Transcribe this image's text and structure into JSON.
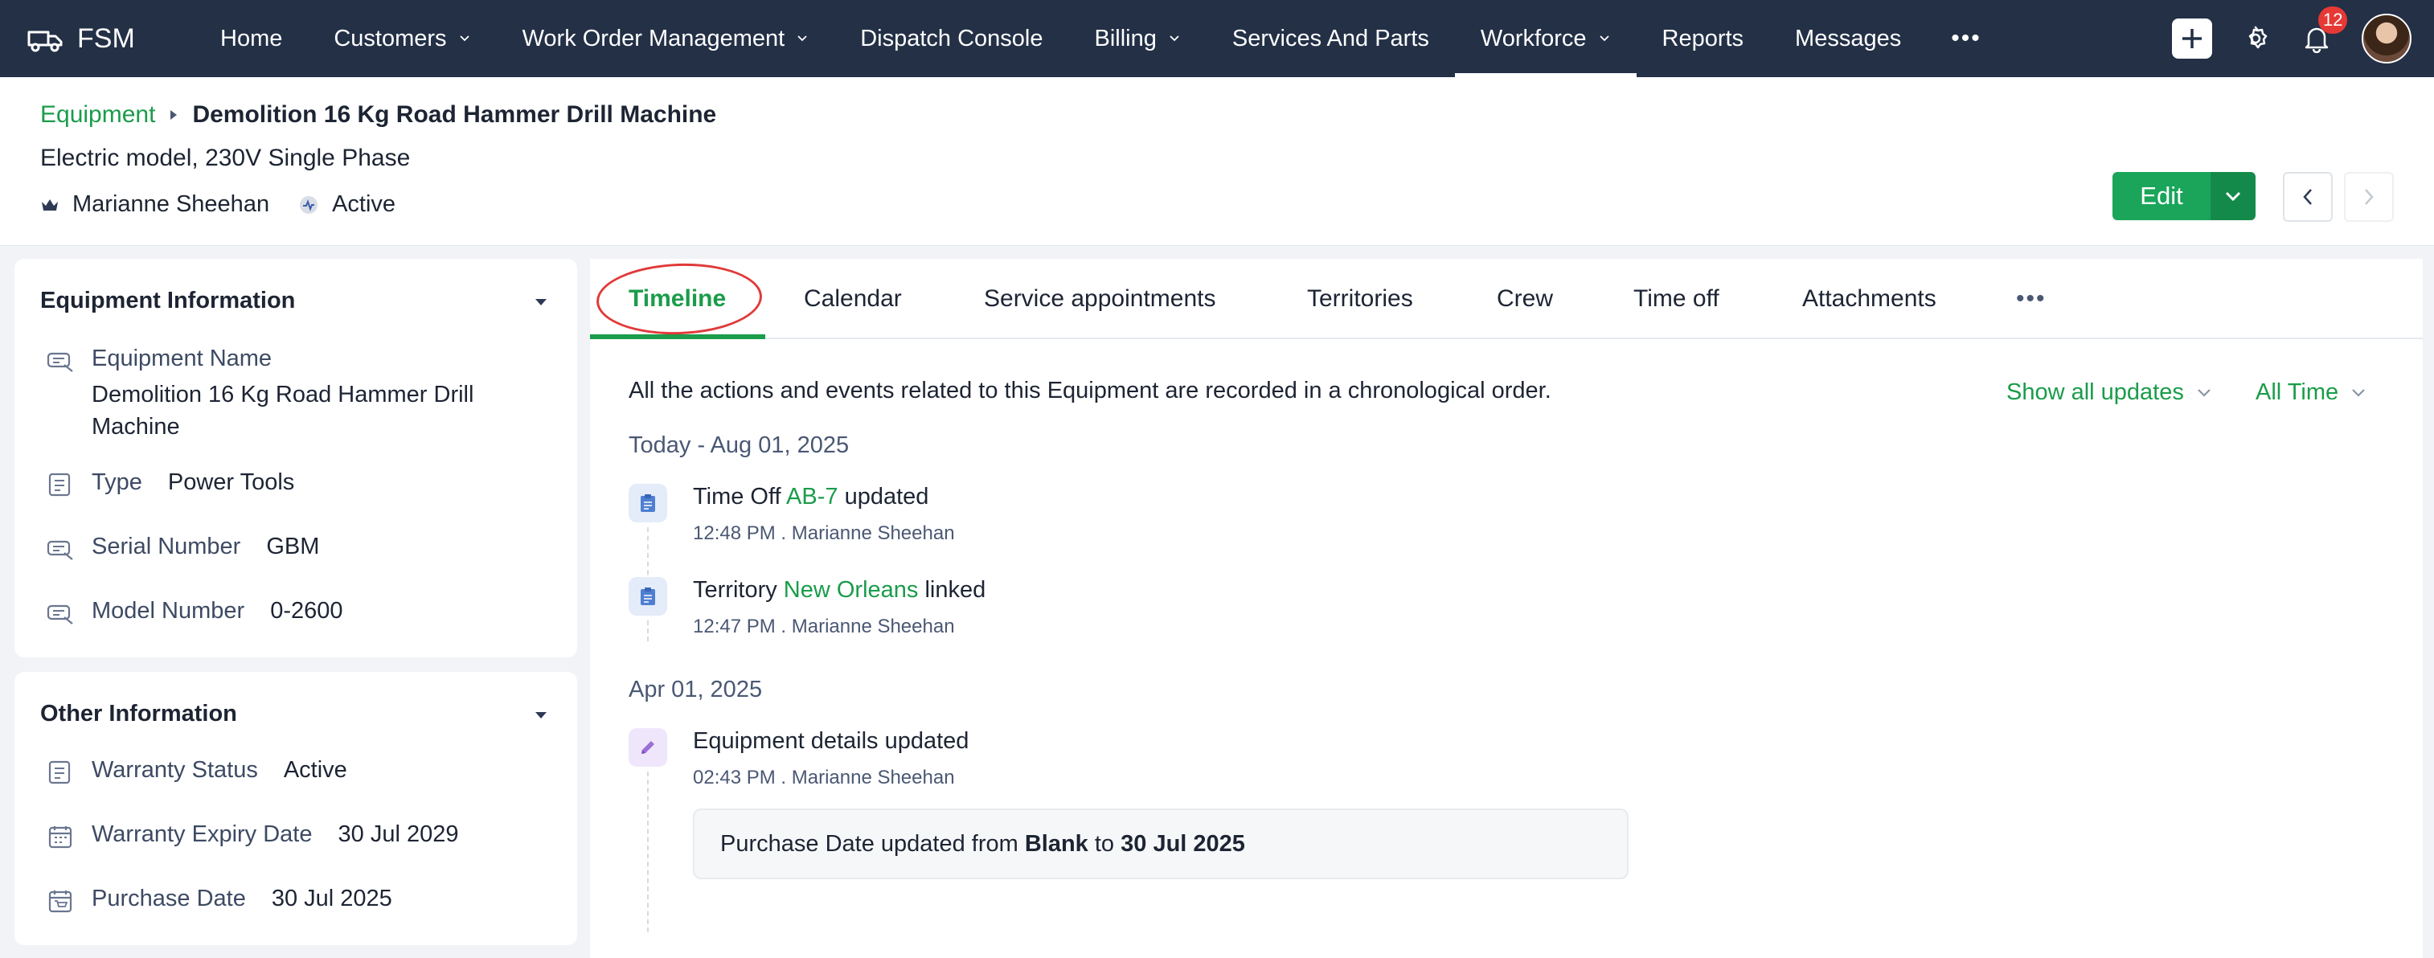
{
  "app": {
    "name": "FSM"
  },
  "nav": {
    "items": [
      {
        "label": "Home",
        "dropdown": false
      },
      {
        "label": "Customers",
        "dropdown": true
      },
      {
        "label": "Work Order Management",
        "dropdown": true
      },
      {
        "label": "Dispatch Console",
        "dropdown": false
      },
      {
        "label": "Billing",
        "dropdown": true
      },
      {
        "label": "Services And Parts",
        "dropdown": false
      },
      {
        "label": "Workforce",
        "dropdown": true,
        "active": true
      },
      {
        "label": "Reports",
        "dropdown": false
      },
      {
        "label": "Messages",
        "dropdown": false
      }
    ],
    "more": "•••",
    "notification_count": "12"
  },
  "header": {
    "breadcrumb_link": "Equipment",
    "title": "Demolition 16 Kg Road Hammer Drill Machine",
    "subtitle": "Electric model, 230V Single Phase",
    "owner": "Marianne Sheehan",
    "status": "Active",
    "edit_label": "Edit"
  },
  "equipment_info": {
    "heading": "Equipment Information",
    "fields": [
      {
        "label": "Equipment Name",
        "value": "Demolition 16 Kg Road Hammer Drill Machine"
      },
      {
        "label": "Type",
        "value": "Power Tools"
      },
      {
        "label": "Serial Number",
        "value": "GBM"
      },
      {
        "label": "Model Number",
        "value": "0-2600"
      }
    ]
  },
  "other_info": {
    "heading": "Other Information",
    "fields": [
      {
        "label": "Warranty Status",
        "value": "Active"
      },
      {
        "label": "Warranty Expiry Date",
        "value": "30 Jul 2029"
      },
      {
        "label": "Purchase Date",
        "value": "30 Jul 2025"
      }
    ]
  },
  "tabs": {
    "items": [
      "Timeline",
      "Calendar",
      "Service appointments",
      "Territories",
      "Crew",
      "Time off",
      "Attachments"
    ],
    "more": "•••",
    "active": "Timeline"
  },
  "timeline": {
    "intro": "All the actions and events related to this Equipment are recorded in a chronological order.",
    "filter_updates": "Show all updates",
    "filter_time": "All Time",
    "groups": [
      {
        "date": "Today - Aug 01, 2025",
        "entries": [
          {
            "prefix": "Time Off ",
            "link": "AB-7",
            "suffix": " updated",
            "meta": "12:48 PM . Marianne Sheehan"
          },
          {
            "prefix": "Territory ",
            "link": "New Orleans",
            "suffix": " linked",
            "meta": "12:47 PM . Marianne Sheehan"
          }
        ]
      },
      {
        "date": "Apr 01, 2025",
        "entries": [
          {
            "prefix": "Equipment details updated",
            "link": "",
            "suffix": "",
            "meta": "02:43 PM . Marianne Sheehan"
          }
        ]
      }
    ],
    "change": {
      "text_a": "Purchase Date updated from ",
      "from": "Blank",
      "text_b": " to ",
      "to": "30 Jul 2025"
    }
  },
  "colors": {
    "nav_bg": "#233046",
    "accent_green": "#1a9c4a",
    "edit_button": "#1aa55a",
    "annotation_circle": "#e03a3a"
  }
}
